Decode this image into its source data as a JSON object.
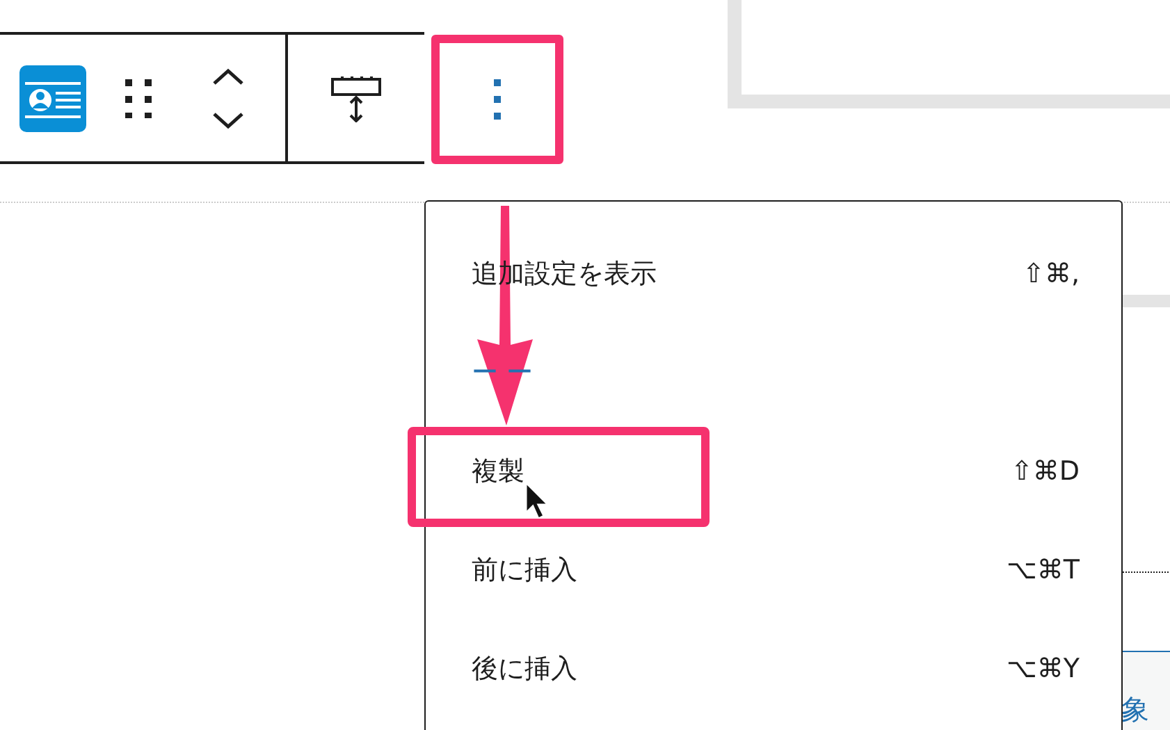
{
  "toolbar": {
    "more_button": {
      "highlighted": true
    }
  },
  "menu": {
    "items": [
      {
        "kind": "item",
        "label": "追加設定を表示",
        "shortcut": "⇧⌘,",
        "highlighted": false
      },
      {
        "kind": "link",
        "label": "ーー",
        "highlighted": false
      },
      {
        "kind": "item",
        "label": "複製",
        "shortcut": "⇧⌘D",
        "highlighted": true
      },
      {
        "kind": "item",
        "label": "前に挿入",
        "shortcut": "⌥⌘T",
        "highlighted": false
      },
      {
        "kind": "item",
        "label": "後に挿入",
        "shortcut": "⌥⌘Y",
        "highlighted": false
      }
    ]
  },
  "background": {
    "link_text": "象"
  }
}
